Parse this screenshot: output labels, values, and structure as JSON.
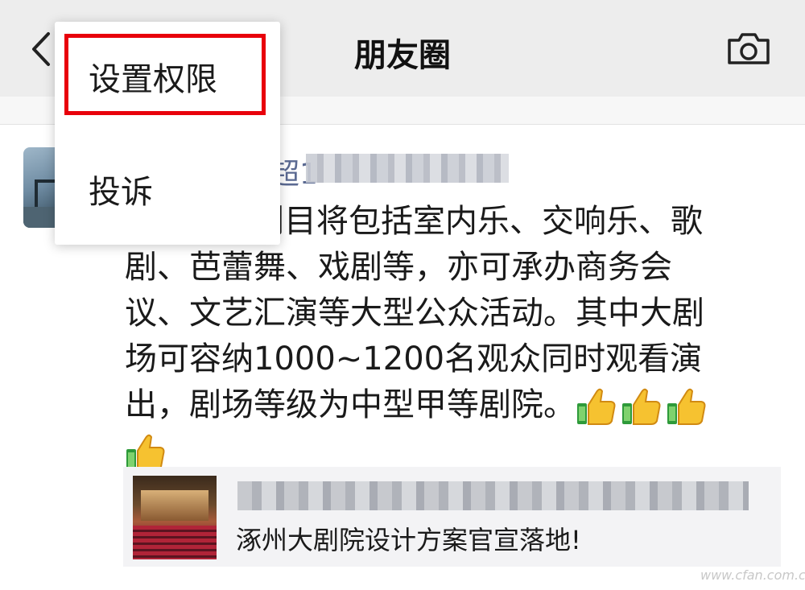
{
  "header": {
    "title": "朋友圈",
    "back_icon": "chevron-left-icon",
    "camera_icon": "camera-icon",
    "background": "#ededed"
  },
  "post": {
    "author_visible": "超1",
    "text_lines": [
      "剧目将包括室内乐、交响乐、歌",
      "剧、芭蕾舞、戏剧等，亦可承办商务会",
      "议、文艺汇演等大型公众活动。其中大剧",
      "场可容纳1000~1200名观众同时观看演",
      "出，剧场等级为中型甲等剧院。"
    ],
    "emoji": [
      "thumbs-up-icon",
      "thumbs-up-icon",
      "thumbs-up-icon",
      "thumbs-up-icon"
    ],
    "link": {
      "title": "涿州大剧院设计方案官宣落地!"
    }
  },
  "popup_menu": {
    "items": [
      {
        "label": "设置权限",
        "highlighted": true
      },
      {
        "label": "投诉",
        "highlighted": false
      }
    ],
    "highlight_color": "#e8000b"
  },
  "watermark": "www.cfan.com.cn"
}
